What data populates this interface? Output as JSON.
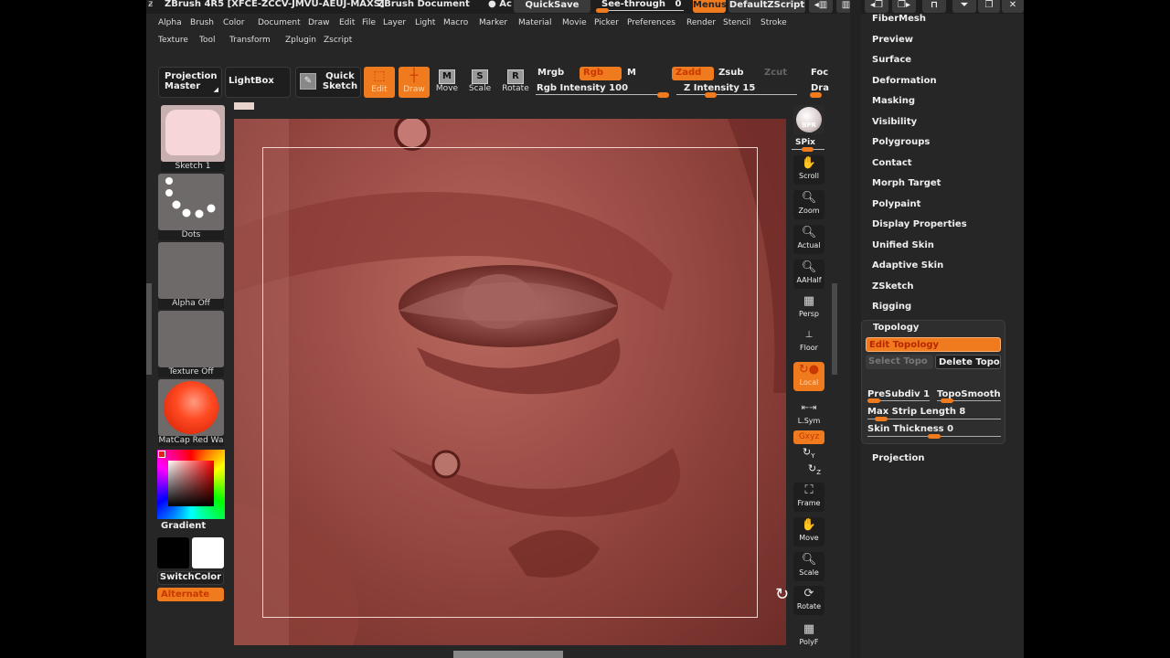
{
  "titlebar": {
    "app_title": "ZBrush 4R5 [XFCE-ZCCV-JMVU-AEUJ-MAXS]",
    "document": "ZBrush Document",
    "active_prefix": "● Ac",
    "quicksave": "QuickSave",
    "see_through_label": "See-through",
    "see_through_value": "0",
    "see_through_fraction": 0,
    "menus": "Menus",
    "default_zscript": "DefaultZScript"
  },
  "menu_row1": [
    "Alpha",
    "Brush",
    "Color",
    "Document",
    "Draw",
    "Edit",
    "File",
    "Layer",
    "Light",
    "Macro",
    "Marker",
    "Material",
    "Movie",
    "Picker",
    "Preferences",
    "Render",
    "Stencil",
    "Stroke"
  ],
  "menu_row2": [
    "Texture",
    "Tool",
    "Transform",
    "Zplugin",
    "Zscript"
  ],
  "toolbar": {
    "projection_master_1": "Projection",
    "projection_master_2": "Master",
    "lightbox": "LightBox",
    "quick_sketch_1": "Quick",
    "quick_sketch_2": "Sketch",
    "edit": "Edit",
    "draw": "Draw",
    "move": "Move",
    "scale": "Scale",
    "rotate": "Rotate",
    "move_key": "M",
    "scale_key": "S",
    "rotate_key": "R",
    "mrgb": "Mrgb",
    "rgb": "Rgb",
    "m": "M",
    "zadd": "Zadd",
    "zsub": "Zsub",
    "zcut": "Zcut",
    "focal": "Foc",
    "rgb_intensity": "Rgb Intensity 100",
    "z_intensity": "Z Intensity 15",
    "draw_size": "Dra",
    "rgb_intensity_value": 100,
    "z_intensity_value": 15
  },
  "left_shelf": {
    "stroke_label": "Sketch 1",
    "dots_label": "Dots",
    "alpha_label": "Alpha Off",
    "texture_label": "Texture Off",
    "material_label": "MatCap Red Wa",
    "gradient": "Gradient",
    "switch_color": "SwitchColor",
    "alternate": "Alternate",
    "main_color": "#000000",
    "secondary_color": "#ffffff"
  },
  "right_shelf": {
    "bpr": "BPR",
    "spix": "SPix",
    "scroll": "Scroll",
    "zoom": "Zoom",
    "actual": "Actual",
    "aahalf": "AAHalf",
    "persp": "Persp",
    "floor": "Floor",
    "local": "Local",
    "lsym": "L.Sym",
    "xyz": "Gxyz",
    "y": "Y",
    "z": "Z",
    "frame": "Frame",
    "move": "Move",
    "scale": "Scale",
    "rotate": "Rotate",
    "polyf": "PolyF"
  },
  "right_panel": {
    "items": [
      "FiberMesh",
      "Preview",
      "Surface",
      "Deformation",
      "Masking",
      "Visibility",
      "Polygroups",
      "Contact",
      "Morph Target",
      "Polypaint",
      "Display Properties",
      "Unified Skin",
      "Adaptive Skin",
      "ZSketch",
      "Rigging"
    ],
    "topology": {
      "title": "Topology",
      "edit_topology": "Edit Topology",
      "select_topo": "Select Topo",
      "delete_topo": "Delete Topo",
      "presubdiv": "PreSubdiv 1",
      "toposmooth": "TopoSmooth",
      "max_strip": "Max Strip Length 8",
      "skin_thickness": "Skin Thickness 0"
    },
    "projection": "Projection"
  },
  "colors": {
    "accent": "#f07a1e",
    "panel": "#262626",
    "button": "#1e1e1e"
  }
}
